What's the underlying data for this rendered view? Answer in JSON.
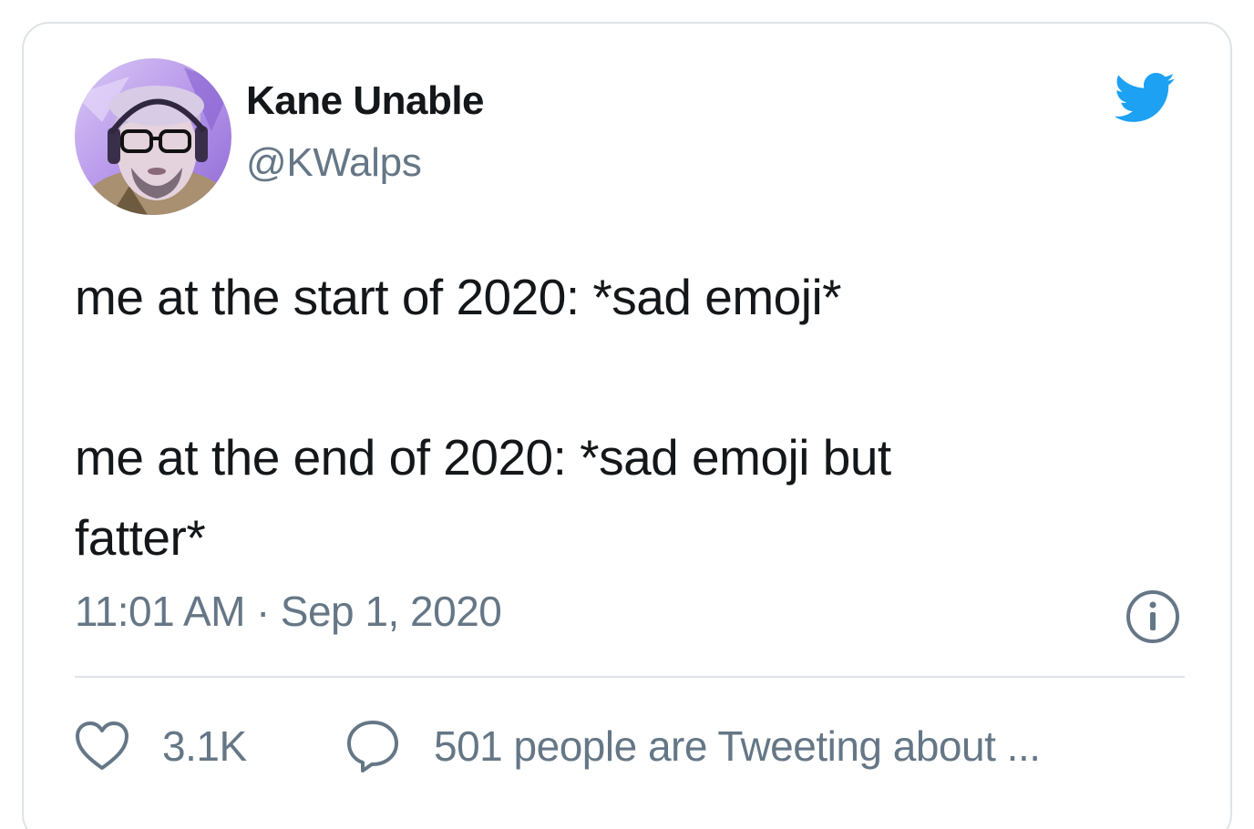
{
  "tweet": {
    "author": {
      "name": "Kane Unable",
      "handle": "@KWalps",
      "avatar_icon": "profile-photo"
    },
    "brand_icon": "twitter-bird-icon",
    "brand_color": "#1da1f2",
    "text": {
      "line1": "me at the start of 2020: *sad emoji*",
      "line2": "me at the end of 2020: *sad emoji but",
      "line3": "fatter*"
    },
    "time": "11:01 AM",
    "separator": "·",
    "date": "Sep 1, 2020",
    "info_icon": "info-icon",
    "likes": {
      "icon": "heart-icon",
      "count": "3.1K"
    },
    "conversation": {
      "icon": "speech-bubble-icon",
      "label": "501 people are Tweeting about ..."
    }
  },
  "colors": {
    "text_primary": "#14171a",
    "text_secondary": "#657786",
    "border": "#dfe3e7"
  }
}
